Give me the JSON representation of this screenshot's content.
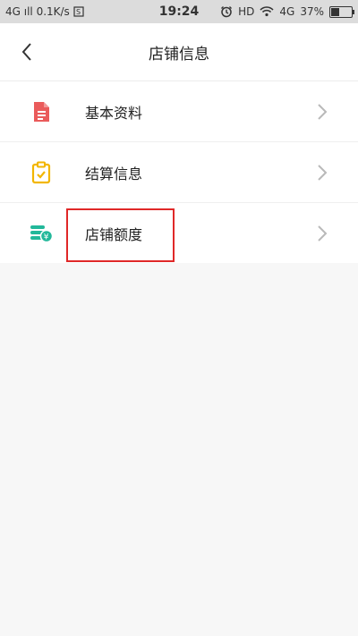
{
  "statusbar": {
    "left": "4G ıll  0.1K/s",
    "time": "19:24",
    "right": "HD",
    "network": "4G",
    "battery": "37%"
  },
  "header": {
    "title": "店铺信息"
  },
  "menu": {
    "items": [
      {
        "label": "基本资料",
        "icon": "document-icon",
        "color": "#ea5b5b"
      },
      {
        "label": "结算信息",
        "icon": "clipboard-check-icon",
        "color": "#f2b600"
      },
      {
        "label": "店铺额度",
        "icon": "coins-yen-icon",
        "color": "#22b89a"
      }
    ]
  }
}
